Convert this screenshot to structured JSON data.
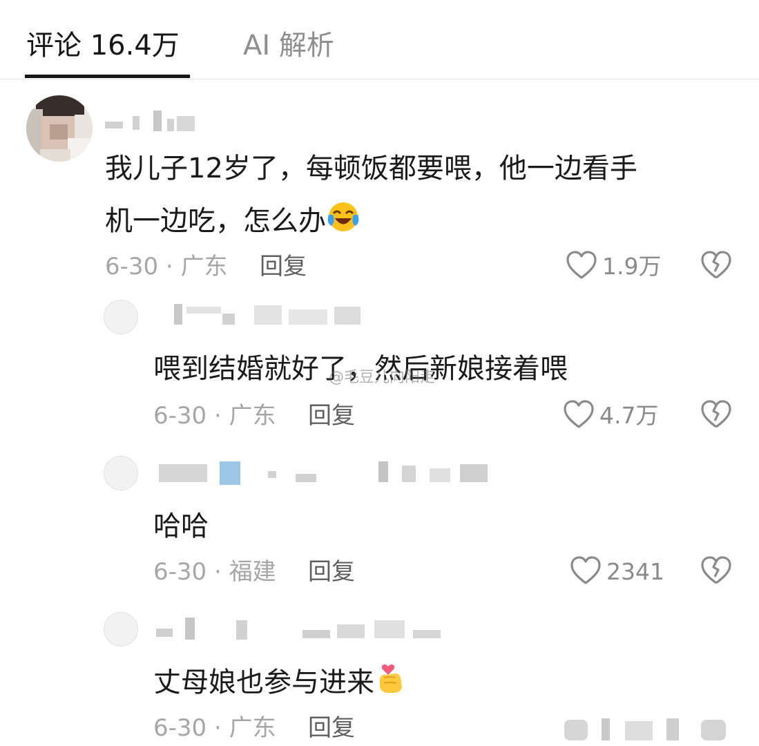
{
  "tabs": [
    {
      "label": "评论 16.4万",
      "active": true
    },
    {
      "label": "AI 解析",
      "active": false
    }
  ],
  "comments": [
    {
      "text_line1": "我儿子12岁了，每顿饭都要喂，他一边看手",
      "text_line2": "机一边吃，怎么办",
      "emoji": "laugh-cry-emoji",
      "date_location": "6-30 · 广东",
      "reply_label": "回复",
      "likes": "1.9万"
    },
    {
      "text": "喂到结婚就好了，然后新娘接着喂",
      "date_location": "6-30 · 广东",
      "reply_label": "回复",
      "likes": "4.7万"
    },
    {
      "text": "哈哈",
      "date_location": "6-30 · 福建",
      "reply_label": "回复",
      "likes": "2341"
    },
    {
      "text": "丈母娘也参与进来",
      "emoji": "finger-heart-emoji",
      "date_location": "6-30 · 广东",
      "reply_label": "回复"
    }
  ],
  "watermark": "@毛豆儿向阳走",
  "colors": {
    "text": "#1a1a1a",
    "meta": "#a6a6a6",
    "reply": "#5f5f5f",
    "tab_inactive": "#8e8e8e"
  }
}
